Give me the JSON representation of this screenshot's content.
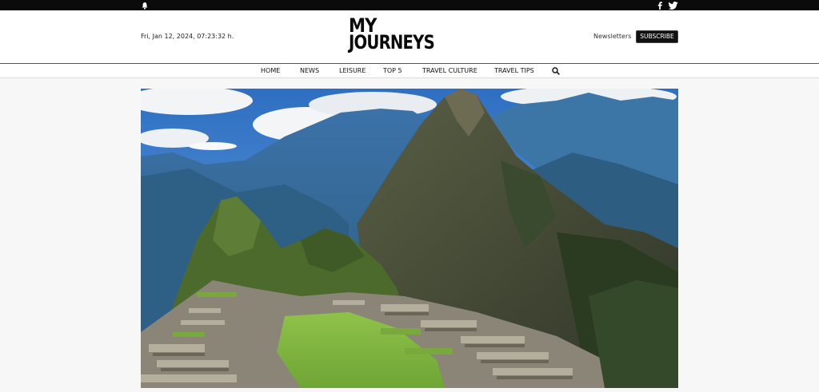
{
  "topbar": {
    "bell_icon": "bell-icon",
    "facebook_icon": "facebook-icon",
    "twitter_icon": "twitter-icon"
  },
  "header": {
    "date": "Fri, Jan 12, 2024, 07:23:32 h.",
    "logo_line1": "MY",
    "logo_line2": "JOURNEYS",
    "newsletters": "Newsletters",
    "subscribe": "SUBSCRIBE"
  },
  "nav": {
    "items": [
      "HOME",
      "NEWS",
      "LEISURE",
      "TOP 5",
      "TRAVEL CULTURE",
      "TRAVEL TIPS"
    ],
    "search_icon": "search-icon"
  },
  "hero": {
    "image": "machu-picchu-photo"
  },
  "colors": {
    "topbar": "#0b0b0b",
    "button": "#111111",
    "sky": "#4a8fd6"
  }
}
